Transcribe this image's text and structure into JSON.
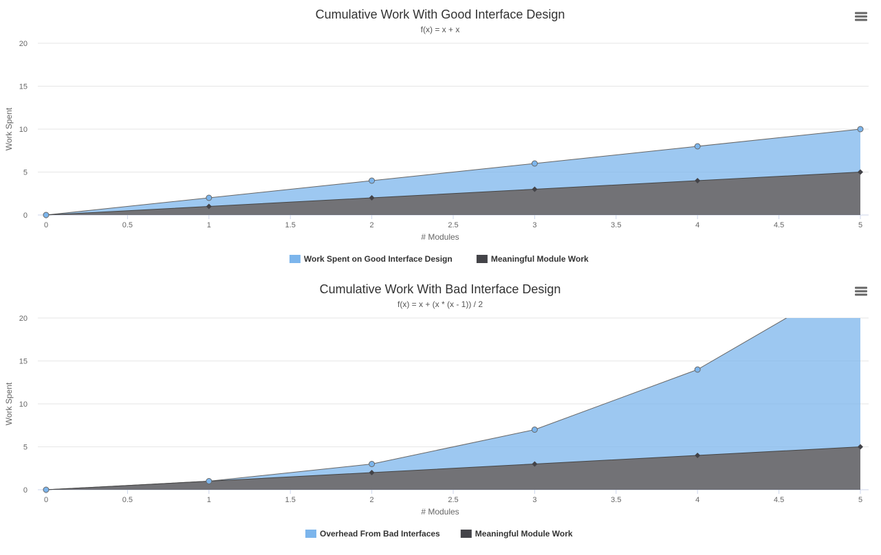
{
  "chart_data": [
    {
      "type": "area",
      "stacking": "normal",
      "title": "Cumulative Work With Good Interface Design",
      "subtitle": "f(x) = x + x",
      "xlabel": "# Modules",
      "ylabel": "Work Spent",
      "x": [
        0,
        1,
        2,
        3,
        4,
        5
      ],
      "xlim": [
        0,
        5
      ],
      "ylim": [
        0,
        20
      ],
      "xticks": [
        "0",
        "0.5",
        "1",
        "1.5",
        "2",
        "2.5",
        "3",
        "3.5",
        "4",
        "4.5",
        "5"
      ],
      "yticks": [
        "0",
        "5",
        "10",
        "15",
        "20"
      ],
      "grid": true,
      "legend": "bottom-center",
      "menu_icon": "hamburger-menu-icon",
      "series": [
        {
          "name": "Work Spent on Good Interface Design",
          "values": [
            0,
            1,
            2,
            3,
            4,
            5
          ],
          "color": "#7cb5ec",
          "marker": "circle"
        },
        {
          "name": "Meaningful Module Work",
          "values": [
            0,
            1,
            2,
            3,
            4,
            5
          ],
          "color": "#434348",
          "marker": "diamond"
        }
      ]
    },
    {
      "type": "area",
      "stacking": "normal",
      "title": "Cumulative Work With Bad Interface Design",
      "subtitle": "f(x) = x + (x * (x - 1)) / 2",
      "xlabel": "# Modules",
      "ylabel": "Work Spent",
      "x": [
        0,
        1,
        2,
        3,
        4,
        5
      ],
      "xlim": [
        0,
        5
      ],
      "ylim": [
        0,
        20
      ],
      "xticks": [
        "0",
        "0.5",
        "1",
        "1.5",
        "2",
        "2.5",
        "3",
        "3.5",
        "4",
        "4.5",
        "5"
      ],
      "yticks": [
        "0",
        "5",
        "10",
        "15",
        "20"
      ],
      "grid": true,
      "legend": "bottom-center",
      "menu_icon": "hamburger-menu-icon",
      "series": [
        {
          "name": "Overhead From Bad Interfaces",
          "values": [
            0,
            0,
            1,
            4,
            10,
            20
          ],
          "color": "#7cb5ec",
          "marker": "circle"
        },
        {
          "name": "Meaningful Module Work",
          "values": [
            0,
            1,
            2,
            3,
            4,
            5
          ],
          "color": "#434348",
          "marker": "diamond"
        }
      ]
    }
  ]
}
